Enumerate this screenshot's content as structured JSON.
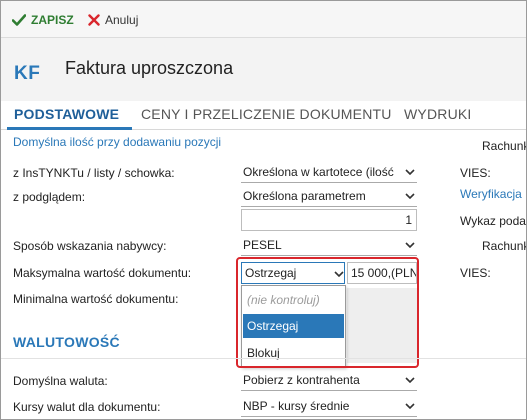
{
  "toolbar": {
    "save_label": "ZAPISZ",
    "cancel_label": "Anuluj",
    "save_icon": "check-icon",
    "cancel_icon": "close-icon"
  },
  "header": {
    "badge": "KF",
    "title": "Faktura uproszczona"
  },
  "tabs": [
    {
      "label": "PODSTAWOWE",
      "active": true
    },
    {
      "label": "CENY I PRZELICZENIE DOKUMENTU",
      "active": false
    },
    {
      "label": "WYDRUKI",
      "active": false
    }
  ],
  "form": {
    "default_qty_link": "Domyślna ilość przy dodawaniu pozycji",
    "rows": [
      {
        "label": "z InsTYNKTu / listy / schowka:",
        "value": "Określona w kartotece (ilość"
      },
      {
        "label": "z podglądem:",
        "value": "Określona parametrem"
      },
      {
        "label": "",
        "number": "1"
      },
      {
        "label": "Sposób wskazania nabywcy:",
        "value": "PESEL"
      },
      {
        "label": "Maksymalna wartość dokumentu:",
        "value": "Ostrzegaj",
        "amount": "15 000,(PLN"
      },
      {
        "label": "Minimalna wartość dokumentu:"
      }
    ],
    "dropdown_options": [
      "(nie kontroluj)",
      "Ostrzegaj",
      "Blokuj"
    ],
    "dropdown_selected": "Ostrzegaj"
  },
  "currency": {
    "section_title": "WALUTOWOŚĆ",
    "rows": [
      {
        "label": "Domyślna waluta:",
        "value": "Pobierz z kontrahenta"
      },
      {
        "label": "Kursy walut dla dokumentu:",
        "value": "NBP - kursy średnie"
      }
    ]
  },
  "right_column": {
    "r1": "Rachunk",
    "r2": "VIES:",
    "r3": "Weryfikacja",
    "r4": "Wykaz poda",
    "r5": "Rachunk",
    "r6": "VIES:"
  },
  "colors": {
    "accent": "#2a78b8",
    "save_green": "#2f7d32",
    "cancel_red": "#d9262c",
    "highlight": "#d9262c"
  }
}
